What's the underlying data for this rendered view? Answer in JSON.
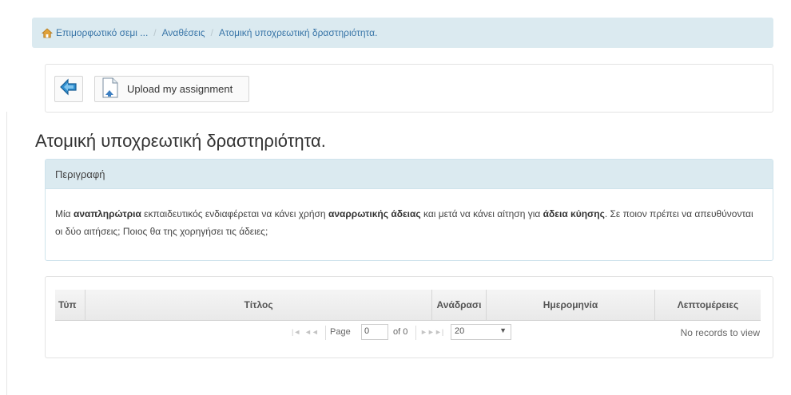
{
  "breadcrumb": {
    "items": [
      "Επιμορφωτικό σεμι ...",
      "Αναθέσεις",
      "Ατομική υποχρεωτική δραστηριότητα."
    ]
  },
  "toolbar": {
    "upload_label": "Upload my assignment"
  },
  "page_title": "Ατομική υποχρεωτική δραστηριότητα.",
  "description": {
    "heading": "Περιγραφή",
    "parts": [
      {
        "text": "Μία ",
        "bold": false
      },
      {
        "text": "αναπληρώτρια",
        "bold": true
      },
      {
        "text": " εκπαιδευτικός ενδιαφέρεται να κάνει χρήση ",
        "bold": false
      },
      {
        "text": "αναρρωτικής άδειας",
        "bold": true
      },
      {
        "text": " και μετά να κάνει αίτηση για ",
        "bold": false
      },
      {
        "text": "άδεια κύησης",
        "bold": true
      },
      {
        "text": ". Σε ποιον πρέπει να απευθύνονται οι δύο αιτήσεις; Ποιος θα της χορηγήσει τις άδειες;",
        "bold": false
      }
    ]
  },
  "grid": {
    "columns": [
      "Τύπ",
      "Τίτλος",
      "Ανάδρασι",
      "Ημερομηνία",
      "Λεπτομέρειες"
    ],
    "pager": {
      "page_label": "Page",
      "page_value": "0",
      "of_label": "of 0",
      "page_size": "20",
      "records_text": "No records to view"
    }
  },
  "colors": {
    "breadcrumb_bg": "#dbeaf0",
    "link": "#3a76a8",
    "home_icon": "#e0a23a"
  }
}
